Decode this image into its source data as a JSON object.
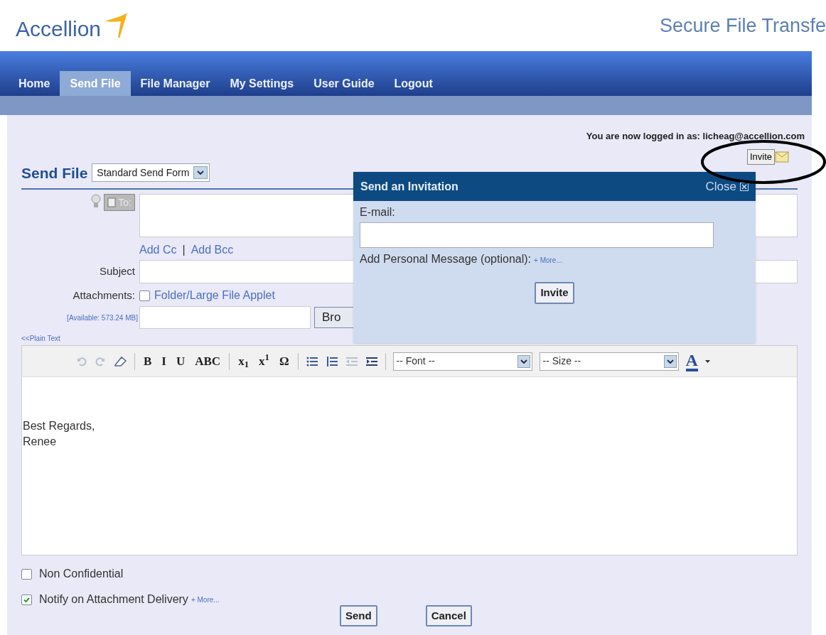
{
  "header": {
    "logo": "Accellion",
    "tagline": "Secure File Transfe"
  },
  "nav": [
    {
      "label": "Home",
      "selected": false
    },
    {
      "label": "Send File",
      "selected": true
    },
    {
      "label": "File Manager",
      "selected": false
    },
    {
      "label": "My Settings",
      "selected": false
    },
    {
      "label": "User Guide",
      "selected": false
    },
    {
      "label": "Logout",
      "selected": false
    }
  ],
  "login_text": "You are now logged in as: licheag@accellion.com",
  "invite_button": "Invite",
  "title": "Send File",
  "form_select": "Standard Send Form",
  "to_button": "To:",
  "add_cc": "Add Cc",
  "separator": "|",
  "add_bcc": "Add Bcc",
  "subject_label": "Subject",
  "attachments_label": "Attachments:",
  "applet": {
    "label": "Folder/Large File Applet",
    "checked": false
  },
  "available": "[Available: 573.24 MB]",
  "browse_button": "Bro",
  "plain_text_link": "<<Plain Text",
  "toolbar": [
    {
      "kind": "undo"
    },
    {
      "kind": "redo"
    },
    {
      "kind": "eraser"
    },
    {
      "kind": "sep"
    },
    {
      "kind": "text",
      "label": "B"
    },
    {
      "kind": "text",
      "label": "I"
    },
    {
      "kind": "text",
      "label": "U"
    },
    {
      "kind": "text",
      "label": "ABC"
    },
    {
      "kind": "sep"
    },
    {
      "kind": "text",
      "label": "x$_{1}$"
    },
    {
      "kind": "text",
      "label": "x$^{1}$"
    },
    {
      "kind": "text",
      "label": "Ω"
    },
    {
      "kind": "sep"
    },
    {
      "kind": "bullets"
    },
    {
      "kind": "numbers"
    },
    {
      "kind": "outdent"
    },
    {
      "kind": "indent"
    },
    {
      "kind": "sep"
    },
    {
      "kind": "select",
      "label": "-- Font --"
    },
    {
      "kind": "select",
      "label": "-- Size --"
    },
    {
      "kind": "color",
      "label": "A"
    }
  ],
  "body_lines": [
    "Best Regards,",
    "Renee"
  ],
  "options": [
    {
      "label": "Non Confidential",
      "checked": false
    },
    {
      "label": "Notify on Attachment Delivery",
      "checked": true,
      "more": "+ More..."
    }
  ],
  "buttons": [
    "Send",
    "Cancel"
  ],
  "popup": {
    "title": "Send an Invitation",
    "close": "Close",
    "email_label": "E-mail:",
    "message_label": "Add Personal Message (optional):",
    "more": "+ More...",
    "button": "Invite"
  }
}
